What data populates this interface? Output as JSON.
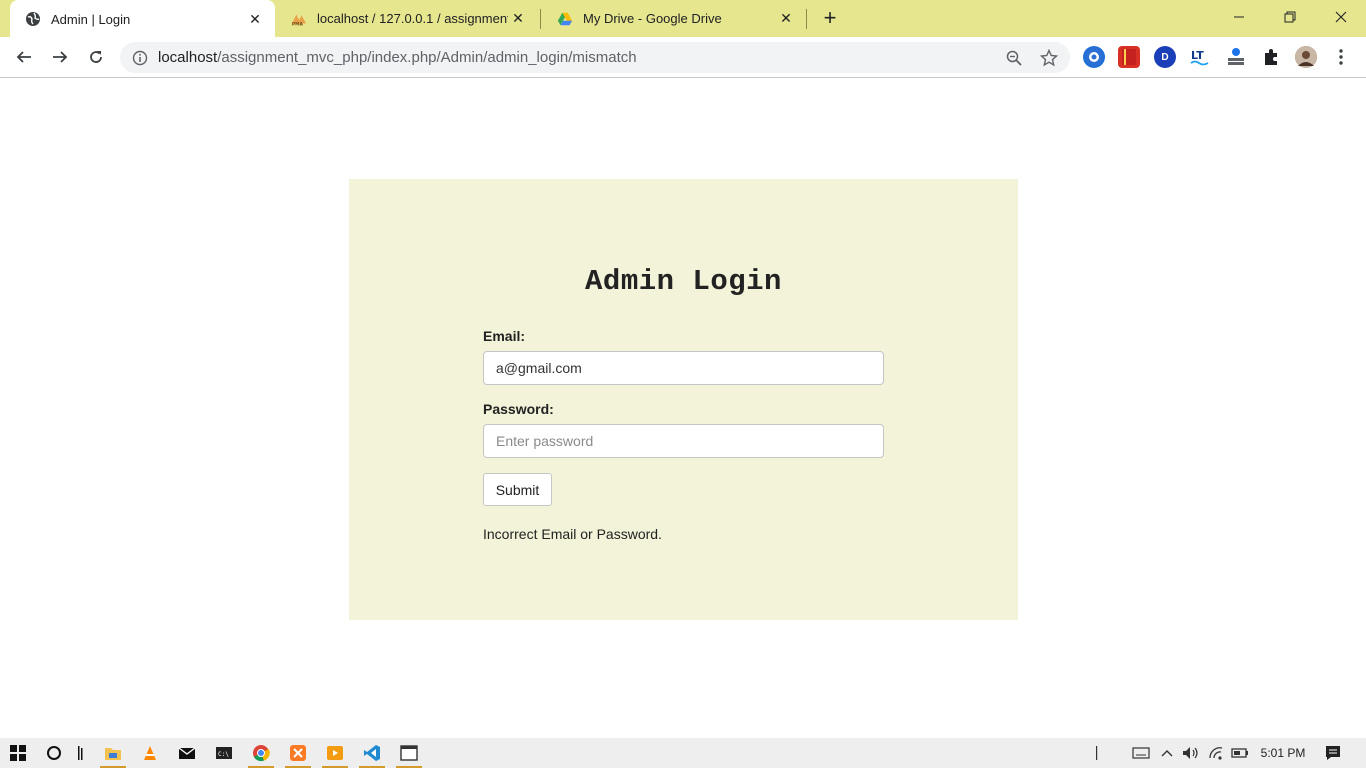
{
  "browser": {
    "tabs": [
      {
        "title": "Admin | Login",
        "icon": "globe-icon",
        "active": true
      },
      {
        "title": "localhost / 127.0.0.1 / assignment",
        "icon": "phpmyadmin-icon",
        "active": false
      },
      {
        "title": "My Drive - Google Drive",
        "icon": "google-drive-icon",
        "active": false
      }
    ],
    "url": {
      "host": "localhost",
      "path": "/assignment_mvc_php/index.php/Admin/admin_login/mismatch"
    },
    "theme_color": "#e6e68e"
  },
  "page": {
    "title": "Admin Login",
    "email_label": "Email:",
    "email_value": "a@gmail.com",
    "password_label": "Password:",
    "password_placeholder": "Enter password",
    "submit_label": "Submit",
    "error_message": "Incorrect Email or Password.",
    "panel_color": "#f3f3d9"
  },
  "taskbar": {
    "clock": "5:01 PM",
    "apps": [
      "windows-start-icon",
      "cortana-icon",
      "task-view-icon",
      "file-explorer-icon",
      "vlc-icon",
      "mail-icon",
      "terminal-icon",
      "chrome-icon",
      "xampp-icon",
      "media-player-icon",
      "vscode-icon",
      "app-window-icon"
    ]
  }
}
